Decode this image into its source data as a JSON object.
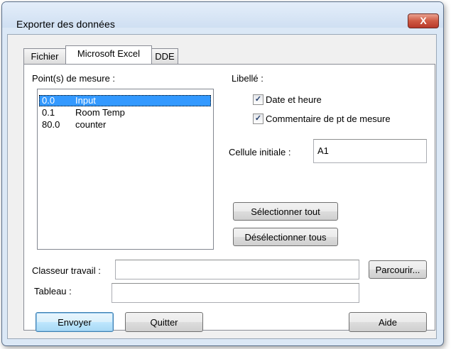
{
  "window": {
    "title": "Exporter des données",
    "close_glyph": "X"
  },
  "tabs": [
    {
      "label": "Fichier"
    },
    {
      "label": "Microsoft Excel",
      "active": true
    },
    {
      "label": "DDE"
    }
  ],
  "points": {
    "label": "Point(s) de mesure :",
    "items": [
      {
        "num": "0.0",
        "name": "Input",
        "selected": true
      },
      {
        "num": "0.1",
        "name": "Room Temp"
      },
      {
        "num": "80.0",
        "name": "counter"
      }
    ]
  },
  "libelle": {
    "label": "Libellé :",
    "date": {
      "label": "Date et heure",
      "checked": true
    },
    "comment": {
      "label": "Commentaire de pt de mesure",
      "checked": true
    }
  },
  "cell": {
    "label": "Cellule initiale :",
    "value": "A1"
  },
  "buttons": {
    "select_all": "Sélectionner tout",
    "deselect_all": "Désélectionner tous",
    "browse": "Parcourir...",
    "send": "Envoyer",
    "quit": "Quitter",
    "help": "Aide"
  },
  "workbook": {
    "label": "Classeur travail :",
    "value": ""
  },
  "sheet": {
    "label": "Tableau :",
    "value": ""
  },
  "check_glyph": "✓"
}
